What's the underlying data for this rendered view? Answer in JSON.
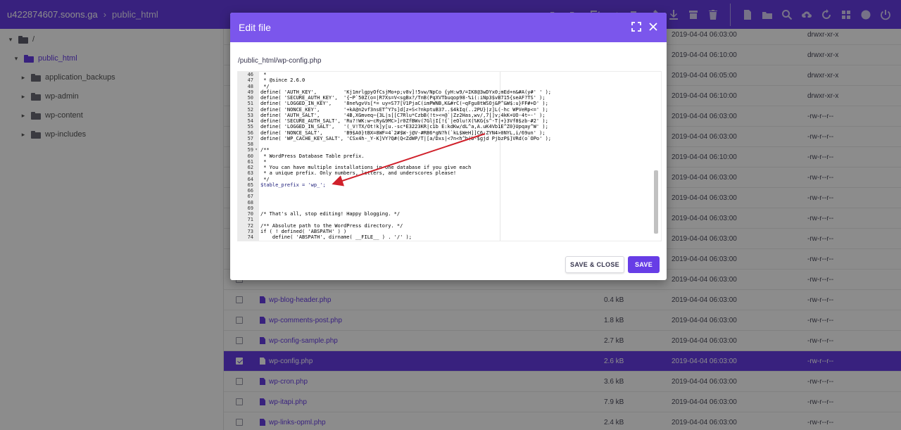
{
  "header": {
    "host": "u422874607.soons.ga",
    "separator": "›",
    "current_dir": "public_html"
  },
  "sidebar": {
    "items": [
      {
        "label": "/",
        "expanded": true,
        "color": "#5b5b6b"
      },
      {
        "label": "public_html",
        "expanded": true,
        "color": "#673de6"
      },
      {
        "label": "application_backups",
        "expanded": false,
        "color": "#6b6b76"
      },
      {
        "label": "wp-admin",
        "expanded": false,
        "color": "#6b6b76"
      },
      {
        "label": "wp-content",
        "expanded": false,
        "color": "#6b6b76"
      },
      {
        "label": "wp-includes",
        "expanded": false,
        "color": "#6b6b76"
      }
    ]
  },
  "files": [
    {
      "name": "",
      "size": "",
      "date": "2019-04-04 06:03:00",
      "perm": "drwxr-xr-x"
    },
    {
      "name": "",
      "size": "",
      "date": "2019-04-04 06:10:00",
      "perm": "drwxr-xr-x"
    },
    {
      "name": "",
      "size": "",
      "date": "2019-04-04 06:05:00",
      "perm": "drwxr-xr-x"
    },
    {
      "name": "",
      "size": "",
      "date": "2019-04-04 06:10:00",
      "perm": "drwxr-xr-x"
    },
    {
      "name": "",
      "size": "",
      "date": "2019-04-04 06:03:00",
      "perm": "-rw-r--r--"
    },
    {
      "name": "",
      "size": "",
      "date": "2019-04-04 06:03:00",
      "perm": "-rw-r--r--"
    },
    {
      "name": "",
      "size": "",
      "date": "2019-04-04 06:10:00",
      "perm": "-rw-r--r--"
    },
    {
      "name": "",
      "size": "",
      "date": "2019-04-04 06:03:00",
      "perm": "-rw-r--r--"
    },
    {
      "name": "",
      "size": "",
      "date": "2019-04-04 06:03:00",
      "perm": "-rw-r--r--"
    },
    {
      "name": "",
      "size": "",
      "date": "2019-04-04 06:03:00",
      "perm": "-rw-r--r--"
    },
    {
      "name": "",
      "size": "",
      "date": "2019-04-04 06:03:00",
      "perm": "-rw-r--r--"
    },
    {
      "name": "",
      "size": "",
      "date": "2019-04-04 06:03:00",
      "perm": "-rw-r--r--"
    },
    {
      "name": "",
      "size": "",
      "date": "2019-04-04 06:03:00",
      "perm": "-rw-r--r--"
    },
    {
      "name": "wp-blog-header.php",
      "size": "0.4 kB",
      "date": "2019-04-04 06:03:00",
      "perm": "-rw-r--r--"
    },
    {
      "name": "wp-comments-post.php",
      "size": "1.8 kB",
      "date": "2019-04-04 06:03:00",
      "perm": "-rw-r--r--"
    },
    {
      "name": "wp-config-sample.php",
      "size": "2.7 kB",
      "date": "2019-04-04 06:03:00",
      "perm": "-rw-r--r--"
    },
    {
      "name": "wp-config.php",
      "size": "2.6 kB",
      "date": "2019-04-04 06:03:00",
      "perm": "-rw-r--r--",
      "selected": true
    },
    {
      "name": "wp-cron.php",
      "size": "3.6 kB",
      "date": "2019-04-04 06:03:00",
      "perm": "-rw-r--r--"
    },
    {
      "name": "wp-itapi.php",
      "size": "7.9 kB",
      "date": "2019-04-04 06:03:00",
      "perm": "-rw-r--r--"
    },
    {
      "name": "wp-links-opml.php",
      "size": "2.4 kB",
      "date": "2019-04-04 06:03:00",
      "perm": "-rw-r--r--"
    }
  ],
  "modal": {
    "title": "Edit file",
    "file_path": "/public_html/wp-config.php",
    "save_close_label": "SAVE & CLOSE",
    "save_label": "SAVE",
    "code_lines": [
      {
        "n": "46",
        "t": " *",
        "cls": "c-comment"
      },
      {
        "n": "47",
        "t": " * @since 2.6.0",
        "cls": "c-comment"
      },
      {
        "n": "48",
        "t": " */",
        "cls": "c-comment"
      },
      {
        "n": "49",
        "t": "define( 'AUTH_KEY',         'Kj1mrlgpyOfCsjMo+p;v8v]!5vw/NpCo {yH:w9/=IK8@3wDYx0;mEd+n&#A(y#' ' );",
        "cls": ""
      },
      {
        "n": "50",
        "t": "define( 'SECURE_AUTH_KEY',  '{~P`50Z(o=|R7Xs=V<sgBx?/TnB(PqXVTbuqop98-%i(:iNp3$vB715{seAF?TS' );",
        "cls": ""
      },
      {
        "n": "51",
        "t": "define( 'LOGGED_IN_KEY',    '8ne%gvVs[*= uy=S77[V1PjaC(imPWNB,K&#rC(~qFgu8tWSOj&P^&W$:u}FF#+D' );",
        "cls": ""
      },
      {
        "n": "52",
        "t": "define( 'NONCE_KEY',        '+kA@n2vf3nsET^Y7s]d[z+S<?nkptuB37..$4kIq(..2PU}|z]L(-hc WPVeRp<=' );",
        "cls": ""
      },
      {
        "n": "53",
        "t": "define( 'AUTH_SALT',        '4B,XGmveq~{3L|s[[C7Rlu*CzbB(!t><=@`|Zz2Has,wv/,7[]v;4kK+UO-4t~-' );",
        "cls": ""
      },
      {
        "n": "54",
        "t": "define( 'SECURE_AUTH_SALT', 'Ru?!WK:w~cRy&9MC>]r0ZfBWv(7GljI[!{`|eOlu!X(%KG{s^-T|+}3Vf8$zb-#2' );",
        "cls": ""
      },
      {
        "n": "55",
        "t": "define( 'LOGGED_IN_SALT',   '(_V!TX/Ot!k]y[u.-sc*E3223KR|c1b E:kdKw/dL^a,A.uK4Vb1E^Z0}Upqay^W' );",
        "cls": ""
      },
      {
        "n": "56",
        "t": "define( 'NONCE_SALT',       'B9$A0}tBX=8WF=4`2#$W-j@V-#RB6*gN?h(`kL$WeH]]C6;ZYN4>0NYL,i/69un' );",
        "cls": ""
      },
      {
        "n": "57",
        "t": "define( 'WP_CACHE_KEY_SALT', 'CSx4h-_Y-K]VY?Q#(Q<ZdWP/T|[a/Dxs|<7n<h^b(b-$gjd PjbzP$]VRd(o`OPo' );",
        "cls": ""
      },
      {
        "n": "58",
        "t": "",
        "cls": ""
      },
      {
        "n": "59",
        "t": "/**",
        "cls": "c-comment",
        "fold": true
      },
      {
        "n": "60",
        "t": " * WordPress Database Table prefix.",
        "cls": "c-comment"
      },
      {
        "n": "61",
        "t": " *",
        "cls": "c-comment"
      },
      {
        "n": "62",
        "t": " * You can have multiple installations in one database if you give each",
        "cls": "c-comment"
      },
      {
        "n": "63",
        "t": " * a unique prefix. Only numbers, letters, and underscores please!",
        "cls": "c-comment"
      },
      {
        "n": "64",
        "t": " */",
        "cls": "c-comment"
      },
      {
        "n": "65",
        "t": "$table_prefix = 'wp_';",
        "cls": "prefix"
      },
      {
        "n": "66",
        "t": "",
        "cls": ""
      },
      {
        "n": "67",
        "t": "",
        "cls": ""
      },
      {
        "n": "68",
        "t": "",
        "cls": ""
      },
      {
        "n": "69",
        "t": "",
        "cls": ""
      },
      {
        "n": "70",
        "t": "/* That's all, stop editing! Happy blogging. */",
        "cls": "c-comment"
      },
      {
        "n": "71",
        "t": "",
        "cls": ""
      },
      {
        "n": "72",
        "t": "/** Absolute path to the WordPress directory. */",
        "cls": "c-comment"
      },
      {
        "n": "73",
        "t": "if ( ! defined( 'ABSPATH' ) )",
        "cls": ""
      },
      {
        "n": "74",
        "t": "    define( 'ABSPATH', dirname( __FILE__ ) . '/' );",
        "cls": ""
      }
    ]
  },
  "colors": {
    "brand": "#673de6",
    "modal_header": "#7b56ec",
    "arrow": "#d0202a"
  },
  "toolbar_icons": [
    "new-folder-icon",
    "folder-icon",
    "edit-icon",
    "move-icon",
    "copy-icon",
    "key-icon",
    "download-icon",
    "archive-icon",
    "trash-icon",
    "new-file-icon",
    "upload-folder-icon",
    "search-icon",
    "cloud-upload-icon",
    "refresh-icon",
    "grid-icon",
    "globe-icon",
    "power-icon"
  ]
}
